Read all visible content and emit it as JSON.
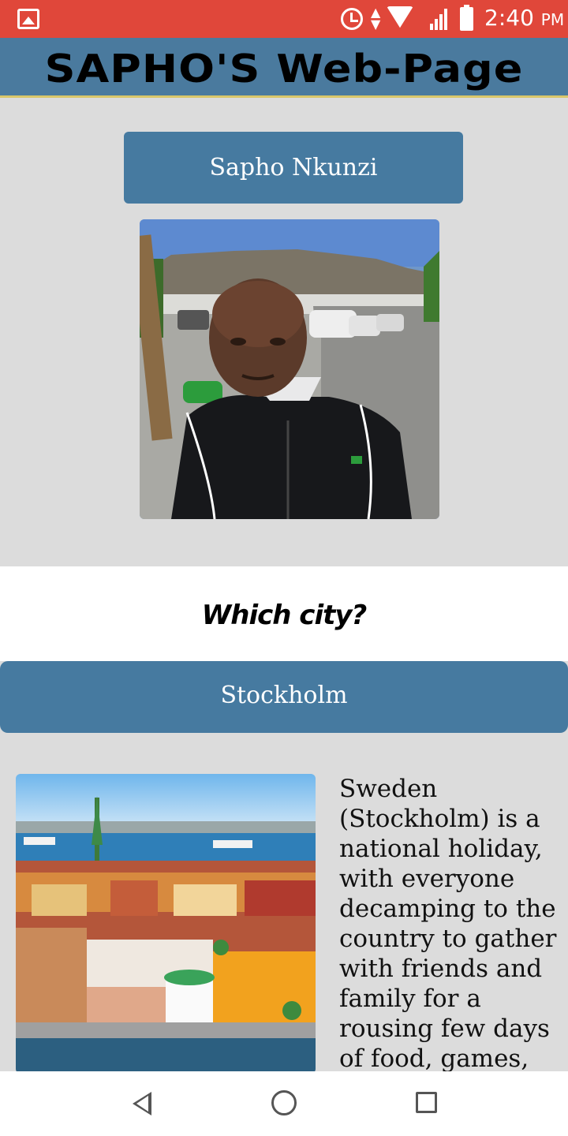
{
  "status_bar": {
    "time": "2:40",
    "ampm": "PM",
    "background_color": "#e0473a",
    "icons": [
      "gallery-icon",
      "alarm-icon",
      "data-arrows-icon",
      "wifi-icon",
      "signal-icon",
      "battery-icon"
    ]
  },
  "header": {
    "title": "SAPHO'S Web-Page",
    "background_color": "#4a7a9e"
  },
  "profile": {
    "name": "Sapho Nkunzi",
    "button_color": "#467aa0"
  },
  "question": {
    "text": "Which city?"
  },
  "city": {
    "name": "Stockholm",
    "description": "Sweden (Stockholm) is a national holiday, with everyone decamping to the country to gather with friends and family for a rousing few days of food, games,"
  },
  "nav_bar": {
    "icons": [
      "back-icon",
      "home-icon",
      "recent-apps-icon"
    ]
  }
}
